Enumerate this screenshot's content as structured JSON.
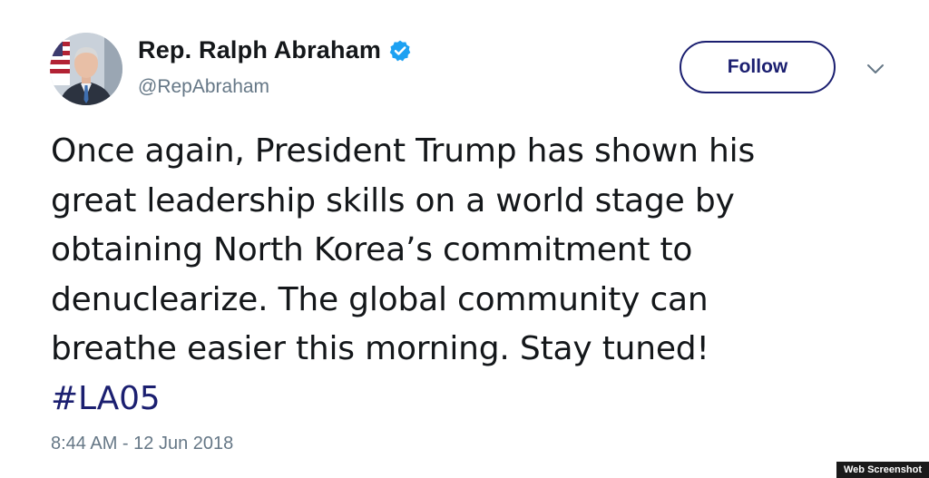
{
  "tweet": {
    "author": {
      "display_name": "Rep. Ralph Abraham",
      "handle": "@RepAbraham",
      "verified_icon": "verified-badge-icon",
      "avatar_icon": "profile-photo"
    },
    "follow_label": "Follow",
    "menu_icon": "chevron-down-icon",
    "text_lines": [
      "Once again, President Trump has shown his",
      "great leadership skills on a world stage by",
      "obtaining North Korea’s commitment to",
      "denuclearize. The global community can",
      "breathe easier this morning. Stay tuned!"
    ],
    "hashtag": "#LA05",
    "timestamp": "8:44 AM - 12 Jun 2018"
  },
  "watermark": "Web Screenshot",
  "colors": {
    "text": "#14171a",
    "secondary": "#657786",
    "accent": "#1b1f70",
    "verified": "#1da1f2"
  }
}
